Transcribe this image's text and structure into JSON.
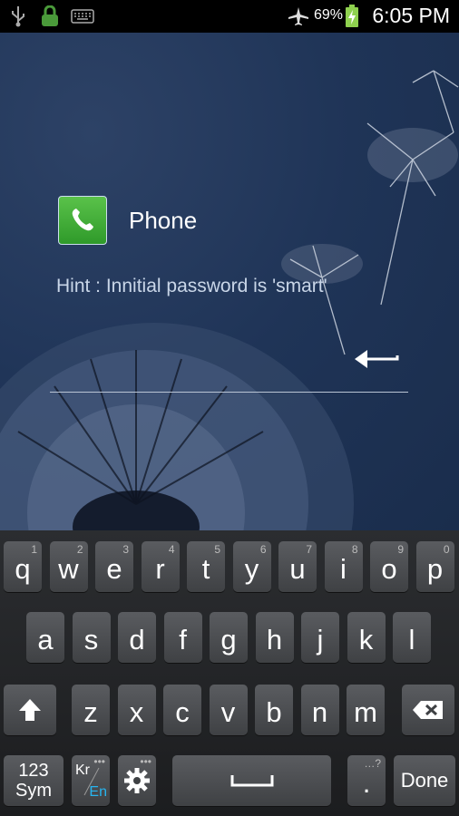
{
  "status_bar": {
    "battery_percent": "69%",
    "time": "6:05 PM",
    "icons": [
      "usb-icon",
      "lock-icon",
      "keyboard-icon",
      "airplane-mode-icon",
      "battery-charging-icon"
    ]
  },
  "app": {
    "name": "Phone",
    "icon": "phone-app-icon"
  },
  "hint": "Hint : Innitial password is 'smart'",
  "keyboard": {
    "row1": [
      {
        "key": "q",
        "sub": "1"
      },
      {
        "key": "w",
        "sub": "2"
      },
      {
        "key": "e",
        "sub": "3"
      },
      {
        "key": "r",
        "sub": "4"
      },
      {
        "key": "t",
        "sub": "5"
      },
      {
        "key": "y",
        "sub": "6"
      },
      {
        "key": "u",
        "sub": "7"
      },
      {
        "key": "i",
        "sub": "8"
      },
      {
        "key": "o",
        "sub": "9"
      },
      {
        "key": "p",
        "sub": "0"
      }
    ],
    "row2": [
      "a",
      "s",
      "d",
      "f",
      "g",
      "h",
      "j",
      "k",
      "l"
    ],
    "row3": [
      "z",
      "x",
      "c",
      "v",
      "b",
      "n",
      "m"
    ],
    "sym_top": "123",
    "sym_bottom": "Sym",
    "lang_top": "Kr",
    "lang_bottom": "En",
    "period": ".",
    "period_sub": "…?",
    "done": "Done"
  }
}
